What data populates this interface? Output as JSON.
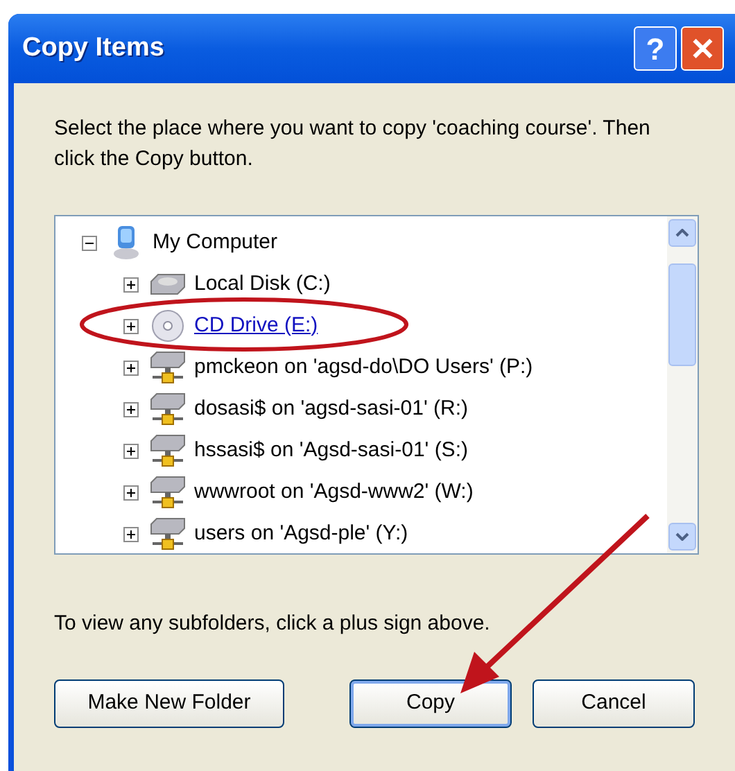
{
  "window": {
    "title": "Copy Items"
  },
  "title_buttons": [
    {
      "kind": "help",
      "label": "?"
    },
    {
      "kind": "close",
      "label": "✕"
    }
  ],
  "instructions": "Select the place where you want to copy 'coaching course'. Then click the Copy button.",
  "tree": {
    "label": "My Computer",
    "kind": "computer",
    "expanded": true,
    "hot": false,
    "children": [
      {
        "label": "Local Disk (C:)",
        "kind": "disk",
        "expanded": false,
        "hot": false
      },
      {
        "label": "CD Drive (E:)",
        "kind": "cd",
        "expanded": false,
        "hot": true
      },
      {
        "label": "pmckeon on 'agsd-do\\DO Users' (P:)",
        "kind": "network",
        "expanded": false,
        "hot": false
      },
      {
        "label": "dosasi$ on 'agsd-sasi-01' (R:)",
        "kind": "network",
        "expanded": false,
        "hot": false
      },
      {
        "label": "hssasi$ on 'Agsd-sasi-01' (S:)",
        "kind": "network",
        "expanded": false,
        "hot": false
      },
      {
        "label": "wwwroot on 'Agsd-www2' (W:)",
        "kind": "network",
        "expanded": false,
        "hot": false
      },
      {
        "label": "users on 'Agsd-ple' (Y:)",
        "kind": "network",
        "expanded": false,
        "hot": false
      }
    ]
  },
  "hint": "To view any subfolders, click a plus sign above.",
  "buttons": [
    {
      "label": "Make New Folder",
      "default": false
    },
    {
      "label": "Copy",
      "default": true
    },
    {
      "label": "Cancel",
      "default": false
    }
  ]
}
